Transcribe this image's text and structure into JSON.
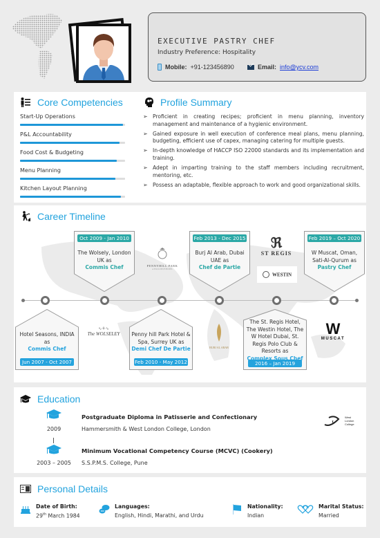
{
  "header": {
    "job_title": "EXECUTIVE PASTRY CHEF",
    "industry_label": "Industry Preference:",
    "industry_value": "Hospitality",
    "mobile_label": "Mobile:",
    "mobile_value": "+91-123456890",
    "email_label": "Email:",
    "email_value": "info@ycv.com"
  },
  "core_competencies": {
    "title": "Core Competencies",
    "icon": "presenter-icon",
    "items": [
      {
        "label": "Start-Up Operations",
        "level": 0.98
      },
      {
        "label": "P&L Accountability",
        "level": 0.95
      },
      {
        "label": "Food Cost & Budgeting",
        "level": 0.92
      },
      {
        "label": "Menu Planning",
        "level": 0.91
      },
      {
        "label": "Kitchen Layout Planning",
        "level": 0.96
      }
    ]
  },
  "profile_summary": {
    "title": "Profile Summary",
    "icon": "head-gears-icon",
    "bullets": [
      "Proficient in creating recipes; proficient in menu planning, inventory management and maintenance of a hygienic environment.",
      "Gained exposure in well execution of conference meal plans, menu planning, budgeting, efficient use of capex, managing catering for multiple guests.",
      "In-depth knowledge of HACCP ISO 22000 standards and its implementation and training.",
      "Adept in imparting training to the staff members including recruitment, mentoring, etc.",
      "Possess an adaptable, flexible approach to work and good organizational skills."
    ]
  },
  "career_timeline": {
    "title": "Career Timeline",
    "icon": "climber-icon",
    "top_cards": [
      {
        "dates": "Oct 2009 - Jan 2010",
        "text": "The Wolsely, London UK as",
        "role": "Commis Chef"
      },
      {
        "dates": "Feb 2013 - Dec 2015",
        "text": "Burj Al Arab, Dubai UAE as",
        "role": "Chef de Partie"
      },
      {
        "dates": "Feb 2019 – Oct 2020",
        "text": "W Muscat, Oman, Sati-Al-Qurum as",
        "role": "Pastry Chef"
      }
    ],
    "bottom_cards": [
      {
        "dates": "Jun 2007 - Oct 2007",
        "text": "Hotel Seasons, INDIA as",
        "role": "Commis Chef"
      },
      {
        "dates": "Feb 2010 - May 2012",
        "text": "Penny hill Park Hotel & Spa, Surrey UK as",
        "role": "Demi Chef De Partie"
      },
      {
        "dates": "2016 – Jan 2019",
        "text": "The St. Regis Hotel, The Westin Hotel, The W Hotel Dubai, St. Regis Polo Club & Resorts as",
        "role": "Complex Sous Chef"
      }
    ],
    "logos": {
      "pennyhill": "PENNYHILL PARK",
      "pennyhill_sub": "A EXCLUSIVE HOTEL",
      "stregis": "ST REGIS",
      "westin": "WESTIN",
      "wolseley": "The WOLSELEY",
      "burj": "BURJ AL ARAB",
      "w_mark": "W",
      "muscat": "MUSCAT"
    }
  },
  "education": {
    "title": "Education",
    "icon": "graduation-cap-icon",
    "entries": [
      {
        "year": "2009",
        "degree": "Postgraduate Diploma in Patisserie and Confectionary",
        "institution": "Hammersmith & West London College, London"
      },
      {
        "year": "2003 – 2005",
        "degree": "Minimum Vocational Competency Course (MCVC) (Cookery)",
        "institution": "S.S.P.M.S. College, Pune"
      }
    ],
    "logo_lines": [
      "West",
      "London",
      "College"
    ]
  },
  "personal_details": {
    "title": "Personal Details",
    "icon": "id-card-icon",
    "dob_label": "Date of Birth:",
    "dob_day": "29",
    "dob_suffix": "th",
    "dob_rest": " March 1984",
    "languages_label": "Languages:",
    "languages_value": "English, Hindi, Marathi, and Urdu",
    "nationality_label": "Nationality:",
    "nationality_value": "Indian",
    "marital_label": "Marital Status:",
    "marital_value": "Married"
  },
  "colors": {
    "accent_blue": "#22a3de",
    "accent_teal": "#2ba8a6",
    "bar_fill": "#1e97d8",
    "page_bg": "#ececec"
  }
}
